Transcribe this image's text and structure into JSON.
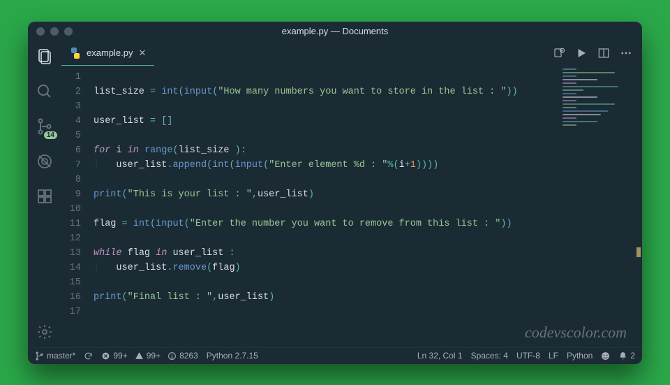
{
  "window": {
    "title": "example.py — Documents"
  },
  "activitybar": {
    "explorer_active": true,
    "scm_badge": "14"
  },
  "tabs": [
    {
      "label": "example.py",
      "active": true
    }
  ],
  "code": {
    "lines": [
      {
        "n": 1,
        "tokens": []
      },
      {
        "n": 2,
        "tokens": [
          {
            "t": "var",
            "v": "list_size"
          },
          {
            "t": "sp",
            "v": " "
          },
          {
            "t": "op",
            "v": "="
          },
          {
            "t": "sp",
            "v": " "
          },
          {
            "t": "builtin",
            "v": "int"
          },
          {
            "t": "op",
            "v": "("
          },
          {
            "t": "builtin",
            "v": "input"
          },
          {
            "t": "op",
            "v": "("
          },
          {
            "t": "str",
            "v": "\"How many numbers you want to store in the list : \""
          },
          {
            "t": "op",
            "v": ")"
          },
          {
            "t": "op",
            "v": ")"
          }
        ]
      },
      {
        "n": 3,
        "tokens": []
      },
      {
        "n": 4,
        "tokens": [
          {
            "t": "var",
            "v": "user_list"
          },
          {
            "t": "sp",
            "v": " "
          },
          {
            "t": "op",
            "v": "="
          },
          {
            "t": "sp",
            "v": " "
          },
          {
            "t": "op",
            "v": "["
          },
          {
            "t": "op",
            "v": "]"
          }
        ]
      },
      {
        "n": 5,
        "tokens": []
      },
      {
        "n": 6,
        "tokens": [
          {
            "t": "kw",
            "v": "for"
          },
          {
            "t": "sp",
            "v": " "
          },
          {
            "t": "var",
            "v": "i"
          },
          {
            "t": "sp",
            "v": " "
          },
          {
            "t": "kw",
            "v": "in"
          },
          {
            "t": "sp",
            "v": " "
          },
          {
            "t": "builtin",
            "v": "range"
          },
          {
            "t": "op",
            "v": "("
          },
          {
            "t": "var",
            "v": "list_size"
          },
          {
            "t": "sp",
            "v": " "
          },
          {
            "t": "op",
            "v": ")"
          },
          {
            "t": "op",
            "v": ":"
          }
        ]
      },
      {
        "n": 7,
        "tokens": [
          {
            "t": "indent",
            "v": "    "
          },
          {
            "t": "var",
            "v": "user_list"
          },
          {
            "t": "op",
            "v": "."
          },
          {
            "t": "builtin",
            "v": "append"
          },
          {
            "t": "op",
            "v": "("
          },
          {
            "t": "builtin",
            "v": "int"
          },
          {
            "t": "op",
            "v": "("
          },
          {
            "t": "builtin",
            "v": "input"
          },
          {
            "t": "op",
            "v": "("
          },
          {
            "t": "str",
            "v": "\"Enter element %d : \""
          },
          {
            "t": "op",
            "v": "%("
          },
          {
            "t": "var",
            "v": "i"
          },
          {
            "t": "op",
            "v": "+"
          },
          {
            "t": "num",
            "v": "1"
          },
          {
            "t": "op",
            "v": ")"
          },
          {
            "t": "op",
            "v": ")"
          },
          {
            "t": "op",
            "v": ")"
          },
          {
            "t": "op",
            "v": ")"
          }
        ]
      },
      {
        "n": 8,
        "tokens": []
      },
      {
        "n": 9,
        "tokens": [
          {
            "t": "builtin",
            "v": "print"
          },
          {
            "t": "op",
            "v": "("
          },
          {
            "t": "str",
            "v": "\"This is your list : \""
          },
          {
            "t": "op",
            "v": ","
          },
          {
            "t": "var",
            "v": "user_list"
          },
          {
            "t": "op",
            "v": ")"
          }
        ]
      },
      {
        "n": 10,
        "tokens": []
      },
      {
        "n": 11,
        "tokens": [
          {
            "t": "var",
            "v": "flag"
          },
          {
            "t": "sp",
            "v": " "
          },
          {
            "t": "op",
            "v": "="
          },
          {
            "t": "sp",
            "v": " "
          },
          {
            "t": "builtin",
            "v": "int"
          },
          {
            "t": "op",
            "v": "("
          },
          {
            "t": "builtin",
            "v": "input"
          },
          {
            "t": "op",
            "v": "("
          },
          {
            "t": "str",
            "v": "\"Enter the number you want to remove from this list : \""
          },
          {
            "t": "op",
            "v": ")"
          },
          {
            "t": "op",
            "v": ")"
          }
        ]
      },
      {
        "n": 12,
        "tokens": []
      },
      {
        "n": 13,
        "tokens": [
          {
            "t": "kw",
            "v": "while"
          },
          {
            "t": "sp",
            "v": " "
          },
          {
            "t": "var",
            "v": "flag"
          },
          {
            "t": "sp",
            "v": " "
          },
          {
            "t": "kw",
            "v": "in"
          },
          {
            "t": "sp",
            "v": " "
          },
          {
            "t": "var",
            "v": "user_list"
          },
          {
            "t": "sp",
            "v": " "
          },
          {
            "t": "op",
            "v": ":"
          }
        ]
      },
      {
        "n": 14,
        "tokens": [
          {
            "t": "indent",
            "v": "    "
          },
          {
            "t": "var",
            "v": "user_list"
          },
          {
            "t": "op",
            "v": "."
          },
          {
            "t": "builtin",
            "v": "remove"
          },
          {
            "t": "op",
            "v": "("
          },
          {
            "t": "var",
            "v": "flag"
          },
          {
            "t": "op",
            "v": ")"
          }
        ]
      },
      {
        "n": 15,
        "tokens": []
      },
      {
        "n": 16,
        "tokens": [
          {
            "t": "builtin",
            "v": "print"
          },
          {
            "t": "op",
            "v": "("
          },
          {
            "t": "str",
            "v": "\"Final list : \""
          },
          {
            "t": "op",
            "v": ","
          },
          {
            "t": "var",
            "v": "user_list"
          },
          {
            "t": "op",
            "v": ")"
          }
        ]
      },
      {
        "n": 17,
        "tokens": []
      }
    ]
  },
  "watermark": "codevscolor.com",
  "statusbar": {
    "branch": "master*",
    "errors": "99+",
    "warnings": "99+",
    "info": "8263",
    "python_version": "Python 2.7.15",
    "cursor": "Ln 32, Col 1",
    "spaces": "Spaces: 4",
    "encoding": "UTF-8",
    "eol": "LF",
    "language": "Python",
    "notifications": "2"
  },
  "colors": {
    "bg": "#1b2b34",
    "accent": "#5fb3b3"
  }
}
